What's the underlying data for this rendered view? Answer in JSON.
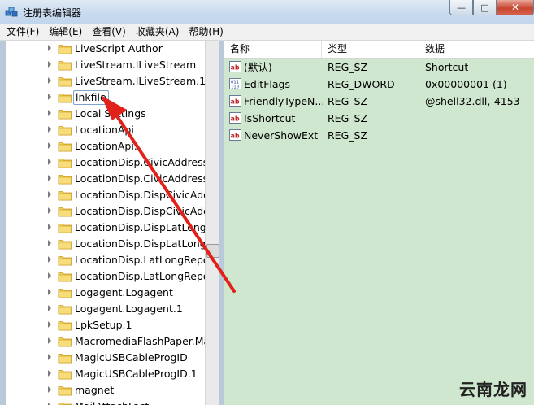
{
  "window": {
    "title": "注册表编辑器",
    "controls": {
      "min": "—",
      "max": "□",
      "close": "✕"
    }
  },
  "menu": [
    "文件(F)",
    "编辑(E)",
    "查看(V)",
    "收藏夹(A)",
    "帮助(H)"
  ],
  "tree": {
    "selected": "lnkfile",
    "items": [
      "LiveScript Author",
      "LiveStream.ILiveStream",
      "LiveStream.ILiveStream.1",
      "lnkfile",
      "Local Settings",
      "LocationApi",
      "LocationApi.",
      "LocationDisp.CivicAddressRe",
      "LocationDisp.CivicAddressRe",
      "LocationDisp.DispCivicAddre",
      "LocationDisp.DispCivicAddre",
      "LocationDisp.DispLatLongRe",
      "LocationDisp.DispLatLongRe",
      "LocationDisp.LatLongReport",
      "LocationDisp.LatLongReport",
      "Logagent.Logagent",
      "Logagent.Logagent.1",
      "LpkSetup.1",
      "MacromediaFlashPaper.Mac",
      "MagicUSBCableProgID",
      "MagicUSBCableProgID.1",
      "magnet",
      "MailAttachFact"
    ]
  },
  "list": {
    "headers": {
      "name": "名称",
      "type": "类型",
      "data": "数据"
    },
    "rows": [
      {
        "icon": "string-value-icon",
        "name": "(默认)",
        "type": "REG_SZ",
        "data": "Shortcut"
      },
      {
        "icon": "binary-value-icon",
        "name": "EditFlags",
        "type": "REG_DWORD",
        "data": "0x00000001 (1)"
      },
      {
        "icon": "string-value-icon",
        "name": "FriendlyTypeN...",
        "type": "REG_SZ",
        "data": "@shell32.dll,-4153"
      },
      {
        "icon": "string-value-icon",
        "name": "IsShortcut",
        "type": "REG_SZ",
        "data": ""
      },
      {
        "icon": "string-value-icon",
        "name": "NeverShowExt",
        "type": "REG_SZ",
        "data": ""
      }
    ]
  },
  "watermark": "云南龙网",
  "colors": {
    "arrow": "#e0221b",
    "list_bg": "#cfe6cf",
    "folder": "#f2cf55"
  }
}
